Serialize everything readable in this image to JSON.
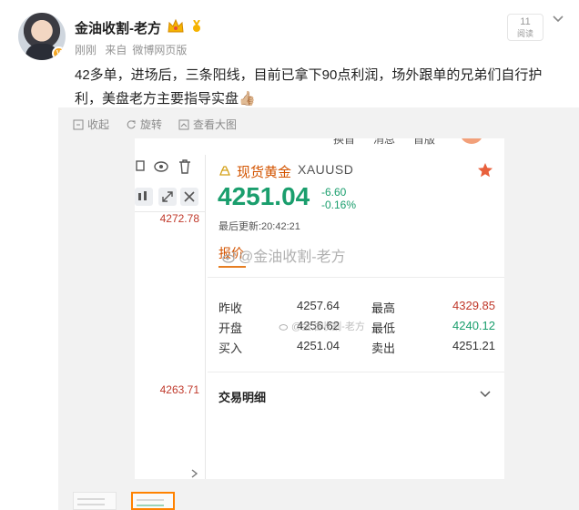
{
  "header": {
    "username": "金油收割-老方",
    "meta": {
      "time": "刚刚",
      "source_prefix": "来自",
      "source": "微博网页版"
    },
    "read_count": {
      "value": "11",
      "label": "阅读"
    }
  },
  "post": {
    "text": "42多单，进场后，三条阳线，目前已拿下90点利润，场外跟单的兄弟们自行护利，美盘老方主要指导实盘👍🏼"
  },
  "actions": [
    {
      "label": "收起",
      "icon": "collapse-icon"
    },
    {
      "label": "旋转",
      "icon": "rotate-icon"
    },
    {
      "label": "查看大图",
      "icon": "zoom-icon"
    }
  ],
  "screenshot": {
    "top_tabs": [
      "换首",
      "消息",
      "首版"
    ],
    "left_prices": [
      "4272.78",
      "4263.71"
    ],
    "instrument": {
      "name": "现货黄金",
      "code": "XAUUSD"
    },
    "price": "4251.04",
    "change": "-6.60",
    "change_pct": "-0.16%",
    "updated": "最后更新:20:42:21",
    "tab": "报价",
    "watermark": "@金油收割-老方",
    "watermark_small": "@金油收割-老方",
    "quotes": [
      {
        "k1": "昨收",
        "v1": "4257.64",
        "k2": "最高",
        "v2": "4329.85",
        "v2_color": "red"
      },
      {
        "k1": "开盘",
        "v1": "4256.62",
        "k2": "最低",
        "v2": "4240.12",
        "v2_color": "green"
      },
      {
        "k1": "买入",
        "v1": "4251.04",
        "k2": "卖出",
        "v2": "4251.21",
        "v2_color": "dark"
      }
    ],
    "trade_detail": "交易明细",
    "colors": {
      "up": "#1a9e6d",
      "down": "#c0392b",
      "accent": "#d35400"
    }
  }
}
